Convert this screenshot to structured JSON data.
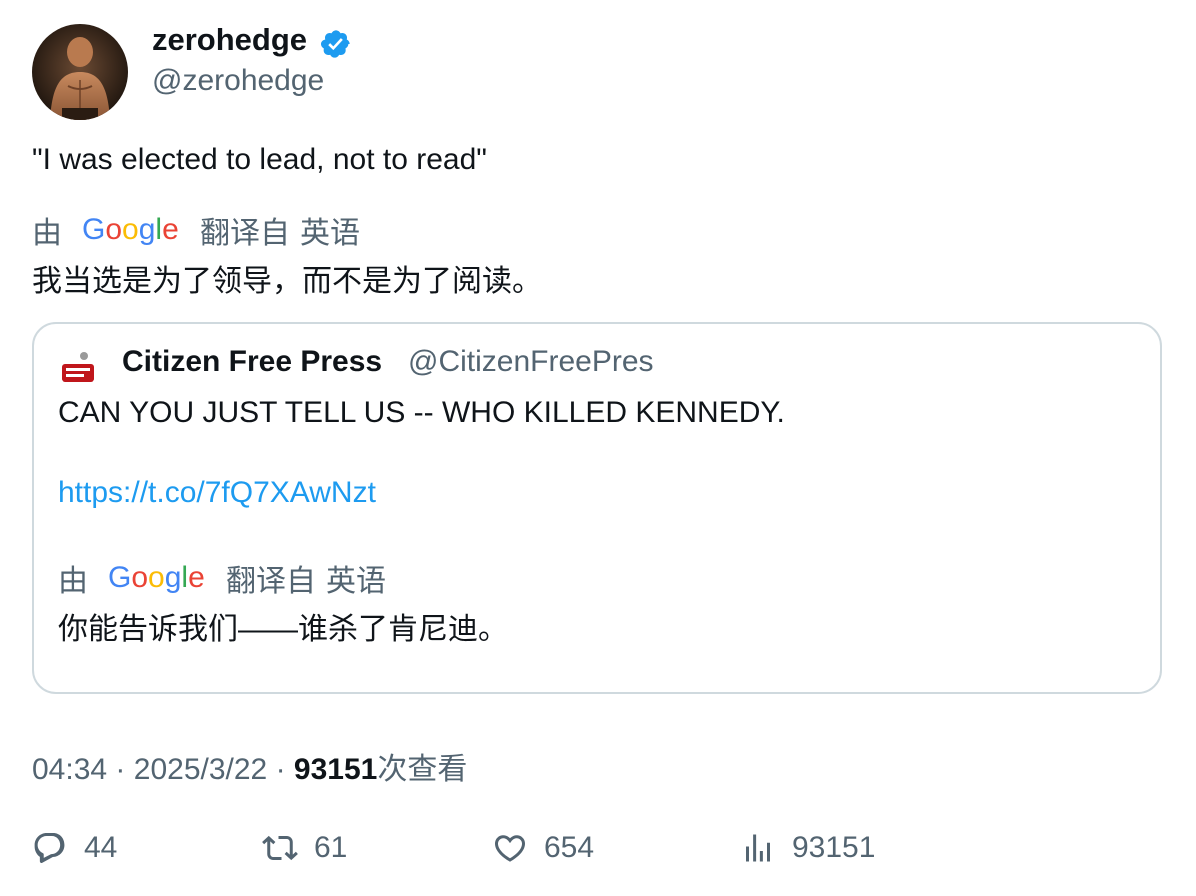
{
  "author": {
    "display_name": "zerohedge",
    "handle": "@zerohedge",
    "verified_icon": "verified-badge-icon",
    "colors": {
      "verified": "#1d9bf0"
    }
  },
  "tweet": {
    "text": "\"I was elected to lead, not to read\"",
    "translation": {
      "by_label": "由",
      "provider_logo": "Google",
      "from_label": "翻译自",
      "language": "英语",
      "text": "我当选是为了领导，而不是为了阅读。"
    }
  },
  "quote": {
    "display_name": "Citizen Free Press",
    "handle": "@CitizenFreePres",
    "text": "CAN YOU JUST TELL US -- WHO KILLED KENNEDY.",
    "link": "https://t.co/7fQ7XAwNzt",
    "translation": {
      "by_label": "由",
      "provider_logo": "Google",
      "from_label": "翻译自",
      "language": "英语",
      "text": "你能告诉我们——谁杀了肯尼迪。"
    }
  },
  "meta": {
    "time": "04:34",
    "separator": "·",
    "date": "2025/3/22",
    "views_count": "93151",
    "views_label": "次查看"
  },
  "actions": {
    "replies": "44",
    "retweets": "61",
    "likes": "654",
    "views": "93151"
  },
  "colors": {
    "text_primary": "#0f1419",
    "text_secondary": "#536471",
    "link": "#1d9bf0",
    "border": "#cfd9de"
  }
}
